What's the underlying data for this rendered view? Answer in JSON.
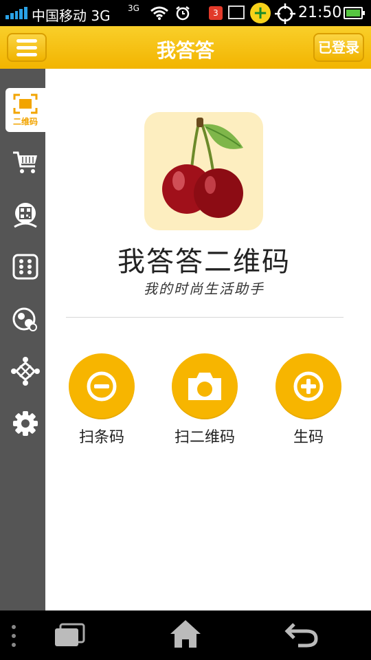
{
  "status_bar": {
    "carrier": "中国移动 3G",
    "network_small": "3G",
    "notification_count": "3",
    "time": "21:50"
  },
  "header": {
    "title": "我答答",
    "login_label": "已登录",
    "menu_icon": "hamburger-menu-icon"
  },
  "sidebar": {
    "items": [
      {
        "icon": "qr-frame-icon",
        "label": "二维码",
        "active": true
      },
      {
        "icon": "shopping-cart-icon",
        "label": ""
      },
      {
        "icon": "qr-scan-person-icon",
        "label": ""
      },
      {
        "icon": "dice-grid-icon",
        "label": ""
      },
      {
        "icon": "bubbles-icon",
        "label": ""
      },
      {
        "icon": "network-people-icon",
        "label": ""
      },
      {
        "icon": "gear-icon",
        "label": ""
      }
    ]
  },
  "main": {
    "app_title": "我答答二维码",
    "app_subtitle": "我的时尚生活助手",
    "actions": [
      {
        "icon": "minus-circle-icon",
        "label": "扫条码"
      },
      {
        "icon": "camera-icon",
        "label": "扫二维码"
      },
      {
        "icon": "plus-circle-icon",
        "label": "生码"
      }
    ]
  },
  "colors": {
    "accent": "#f7b500",
    "header": "#f5c21a",
    "sidebar": "#555555"
  }
}
